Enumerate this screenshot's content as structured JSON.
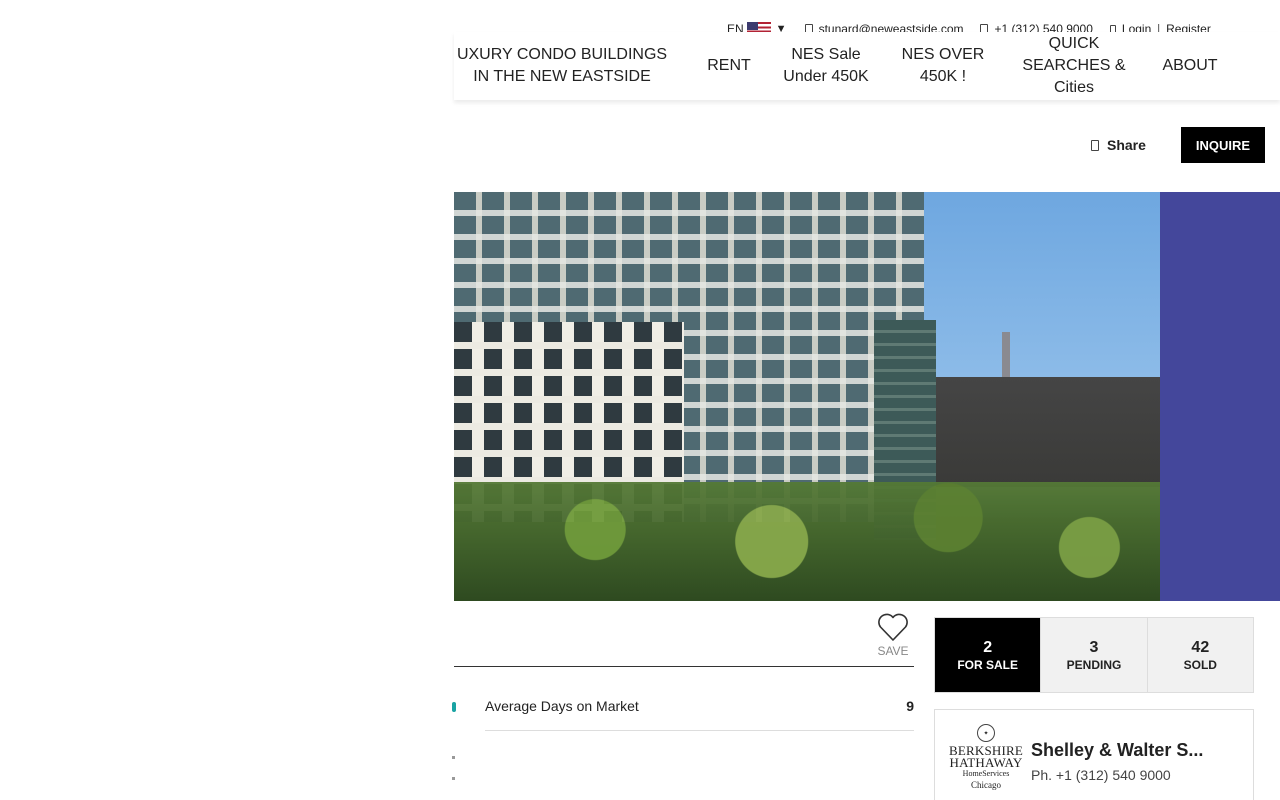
{
  "utility": {
    "language": "EN",
    "email": "stunard@neweastside.com",
    "phone": "+1 (312) 540 9000",
    "login": "Login",
    "separator": "|",
    "register": "Register"
  },
  "nav": {
    "brand": "UXURY CONDO BUILDINGS IN THE NEW EASTSIDE",
    "items": [
      {
        "label": "RENT"
      },
      {
        "label": "NES Sale Under 450K"
      },
      {
        "label": "NES OVER 450K !"
      },
      {
        "label": "QUICK SEARCHES & Cities"
      },
      {
        "label": "ABOUT"
      }
    ]
  },
  "actions": {
    "share": "Share",
    "inquire": "INQUIRE"
  },
  "save": {
    "label": "SAVE"
  },
  "stats": [
    {
      "label": "Average Days on Market",
      "value": "9"
    }
  ],
  "counts": [
    {
      "num": "2",
      "label": "FOR SALE"
    },
    {
      "num": "3",
      "label": "PENDING"
    },
    {
      "num": "42",
      "label": "SOLD"
    }
  ],
  "agent": {
    "logo": {
      "line1": "BERKSHIRE",
      "line2": "HATHAWAY",
      "line3": "HomeServices",
      "line4": "Chicago"
    },
    "name": "Shelley & Walter S...",
    "phone": "Ph. +1 (312) 540 9000"
  },
  "colors": {
    "accent": "#000000",
    "hero_side": "#44479b",
    "stat_dot": "#1aa3a3"
  },
  "icons": [
    "flag-us-icon",
    "caret-down-icon",
    "email-icon",
    "phone-icon",
    "login-icon",
    "share-icon",
    "heart-icon"
  ]
}
